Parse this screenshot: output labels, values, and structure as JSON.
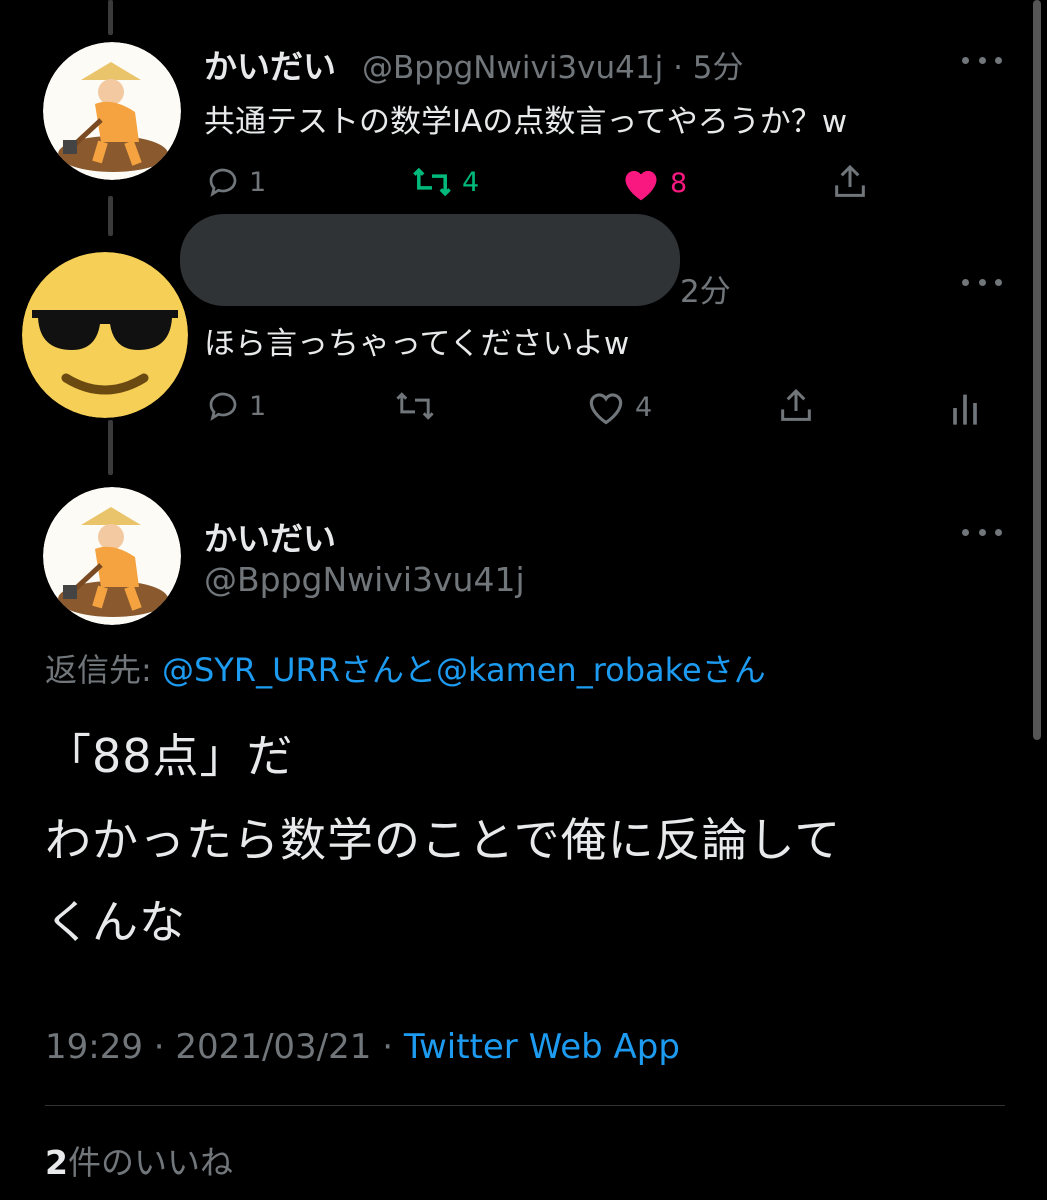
{
  "tweet1": {
    "name": "かいだい",
    "handle": "@BppgNwivi3vu41j",
    "sep": "·",
    "time": "5分",
    "text": "共通テストの数学IAの点数言ってやろうか？w",
    "replies": "1",
    "retweets": "4",
    "likes": "8",
    "retweet_color": "#00ba7c",
    "like_color": "#f91880"
  },
  "tweet2": {
    "time": "2分",
    "text": "ほら言っちゃってくださいよw",
    "replies": "1",
    "likes": "4"
  },
  "main": {
    "name": "かいだい",
    "handle": "@BppgNwivi3vu41j",
    "reply_label": "返信先:",
    "reply_user1": "@SYR_URRさん",
    "reply_and": "と",
    "reply_user2": "@kamen_robakeさん",
    "text_line1": "「88点」だ",
    "text_line2": "わかったら数学のことで俺に反論して",
    "text_line3": "くんな",
    "time": "19:29",
    "date": "2021/03/21",
    "sep": "·",
    "source": "Twitter Web App",
    "likes_count": "2",
    "likes_label": "件のいいね"
  },
  "colors": {
    "background": "#000000",
    "link": "#1d9bf0",
    "muted": "#71767b"
  }
}
